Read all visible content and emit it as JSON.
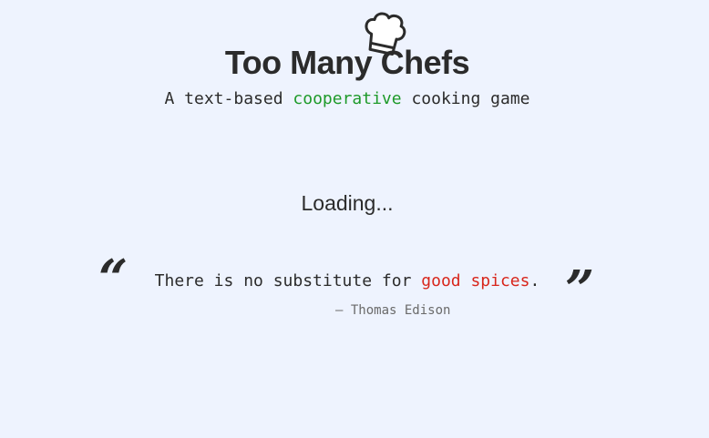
{
  "header": {
    "logo_icon": "chef-hat-icon",
    "title": "Too Many Chefs",
    "subtitle_prefix": "A text-based ",
    "subtitle_highlight": "cooperative",
    "subtitle_suffix": " cooking game"
  },
  "status": {
    "loading_text": "Loading..."
  },
  "quote": {
    "open_mark": "“",
    "close_mark": "”",
    "text_prefix": "There is no substitute for ",
    "text_highlight": "good spices",
    "text_suffix": ".",
    "attribution": "— Thomas Edison"
  },
  "colors": {
    "background": "#eef3fe",
    "text": "#2b2b2b",
    "highlight_green": "#1e9a2a",
    "highlight_red": "#d8261c",
    "attribution": "#6a6a6a"
  }
}
